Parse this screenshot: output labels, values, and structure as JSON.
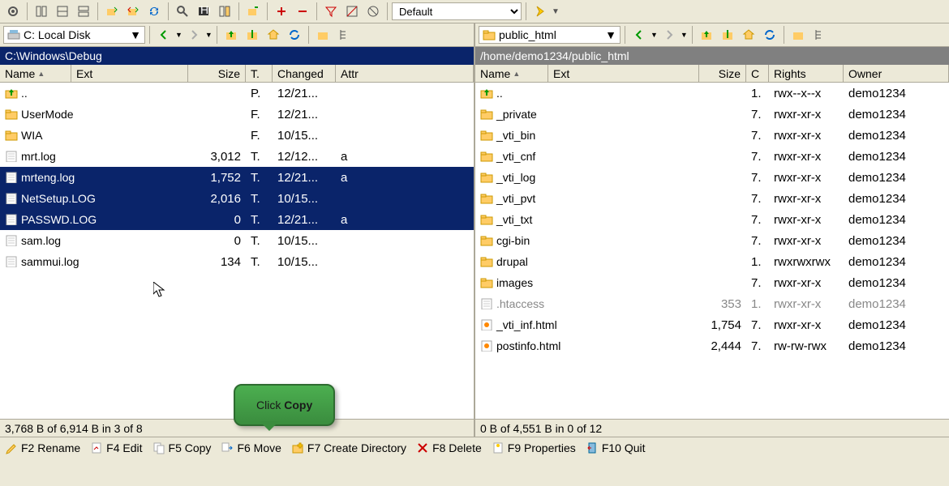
{
  "toolbar": {
    "filter_select": "Default"
  },
  "left": {
    "drive": "C: Local Disk",
    "path": "C:\\Windows\\Debug",
    "headers": [
      "Name",
      "Ext",
      "Size",
      "T.",
      "Changed",
      "Attr"
    ],
    "rows": [
      {
        "icon": "up",
        "name": "..",
        "ext": "",
        "size": "",
        "type": "P.",
        "changed": "12/21...",
        "attr": "",
        "sel": false
      },
      {
        "icon": "folder",
        "name": "UserMode",
        "ext": "",
        "size": "",
        "type": "F.",
        "changed": "12/21...",
        "attr": "",
        "sel": false
      },
      {
        "icon": "folder",
        "name": "WIA",
        "ext": "",
        "size": "",
        "type": "F.",
        "changed": "10/15...",
        "attr": "",
        "sel": false
      },
      {
        "icon": "file",
        "name": "mrt.log",
        "ext": "",
        "size": "3,012",
        "type": "T.",
        "changed": "12/12...",
        "attr": "a",
        "sel": false
      },
      {
        "icon": "file",
        "name": "mrteng.log",
        "ext": "",
        "size": "1,752",
        "type": "T.",
        "changed": "12/21...",
        "attr": "a",
        "sel": true
      },
      {
        "icon": "file",
        "name": "NetSetup.LOG",
        "ext": "",
        "size": "2,016",
        "type": "T.",
        "changed": "10/15...",
        "attr": "",
        "sel": true
      },
      {
        "icon": "file",
        "name": "PASSWD.LOG",
        "ext": "",
        "size": "0",
        "type": "T.",
        "changed": "12/21...",
        "attr": "a",
        "sel": true
      },
      {
        "icon": "file",
        "name": "sam.log",
        "ext": "",
        "size": "0",
        "type": "T.",
        "changed": "10/15...",
        "attr": "",
        "sel": false
      },
      {
        "icon": "file",
        "name": "sammui.log",
        "ext": "",
        "size": "134",
        "type": "T.",
        "changed": "10/15...",
        "attr": "",
        "sel": false
      }
    ],
    "status": "3,768 B of 6,914 B in 3 of 8"
  },
  "right": {
    "drive": "public_html",
    "path": "/home/demo1234/public_html",
    "headers": [
      "Name",
      "Ext",
      "Size",
      "C",
      "Rights",
      "Owner"
    ],
    "rows": [
      {
        "icon": "up",
        "name": "..",
        "size": "",
        "c": "1.",
        "rights": "rwx--x--x",
        "owner": "demo1234"
      },
      {
        "icon": "folder",
        "name": "_private",
        "size": "",
        "c": "7.",
        "rights": "rwxr-xr-x",
        "owner": "demo1234"
      },
      {
        "icon": "folder",
        "name": "_vti_bin",
        "size": "",
        "c": "7.",
        "rights": "rwxr-xr-x",
        "owner": "demo1234"
      },
      {
        "icon": "folder",
        "name": "_vti_cnf",
        "size": "",
        "c": "7.",
        "rights": "rwxr-xr-x",
        "owner": "demo1234"
      },
      {
        "icon": "folder",
        "name": "_vti_log",
        "size": "",
        "c": "7.",
        "rights": "rwxr-xr-x",
        "owner": "demo1234"
      },
      {
        "icon": "folder",
        "name": "_vti_pvt",
        "size": "",
        "c": "7.",
        "rights": "rwxr-xr-x",
        "owner": "demo1234"
      },
      {
        "icon": "folder",
        "name": "_vti_txt",
        "size": "",
        "c": "7.",
        "rights": "rwxr-xr-x",
        "owner": "demo1234"
      },
      {
        "icon": "folder",
        "name": "cgi-bin",
        "size": "",
        "c": "7.",
        "rights": "rwxr-xr-x",
        "owner": "demo1234"
      },
      {
        "icon": "folder",
        "name": "drupal",
        "size": "",
        "c": "1.",
        "rights": "rwxrwxrwx",
        "owner": "demo1234"
      },
      {
        "icon": "folder",
        "name": "images",
        "size": "",
        "c": "7.",
        "rights": "rwxr-xr-x",
        "owner": "demo1234"
      },
      {
        "icon": "file",
        "name": ".htaccess",
        "size": "353",
        "c": "1.",
        "rights": "rwxr-xr-x",
        "owner": "demo1234",
        "dim": true
      },
      {
        "icon": "html",
        "name": "_vti_inf.html",
        "size": "1,754",
        "c": "7.",
        "rights": "rwxr-xr-x",
        "owner": "demo1234"
      },
      {
        "icon": "html",
        "name": "postinfo.html",
        "size": "2,444",
        "c": "7.",
        "rights": "rw-rw-rwx",
        "owner": "demo1234"
      }
    ],
    "status": "0 B of 4,551 B in 0 of 12"
  },
  "fkeys": [
    {
      "key": "F2",
      "label": "Rename"
    },
    {
      "key": "F4",
      "label": "Edit"
    },
    {
      "key": "F5",
      "label": "Copy"
    },
    {
      "key": "F6",
      "label": "Move"
    },
    {
      "key": "F7",
      "label": "Create Directory"
    },
    {
      "key": "F8",
      "label": "Delete"
    },
    {
      "key": "F9",
      "label": "Properties"
    },
    {
      "key": "F10",
      "label": "Quit"
    }
  ],
  "tooltip": {
    "prefix": "Click ",
    "bold": "Copy"
  }
}
